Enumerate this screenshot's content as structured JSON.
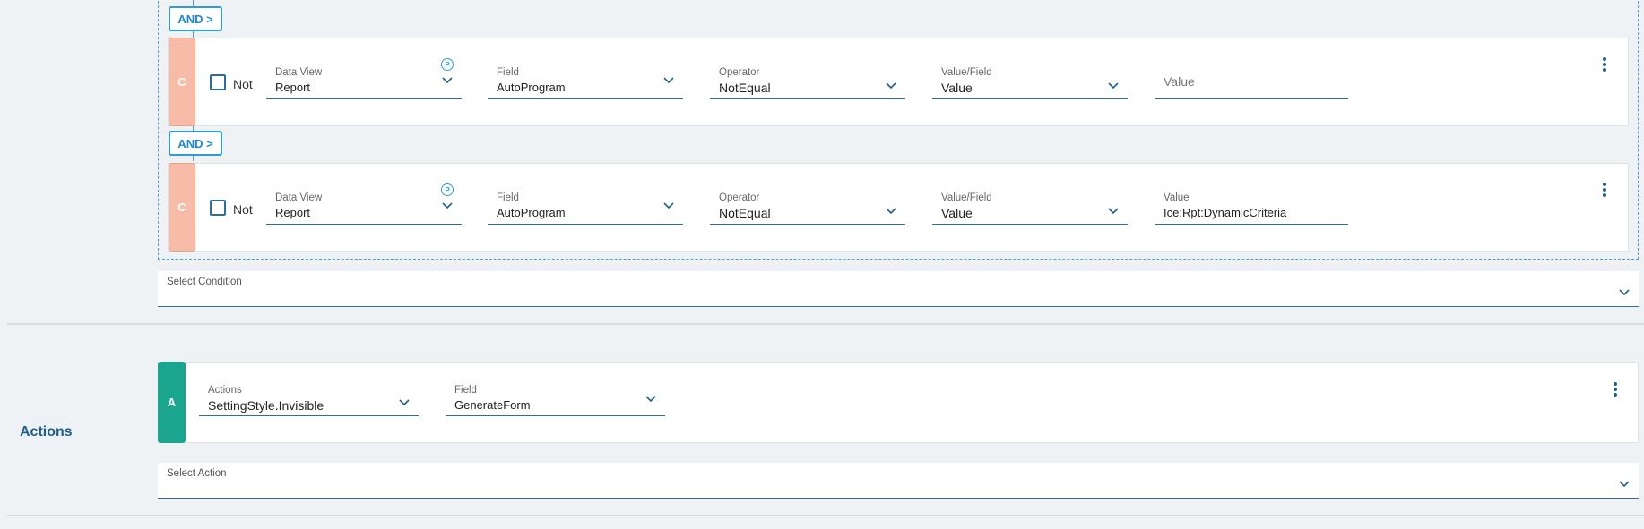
{
  "conditions": {
    "connector_label": "AND >",
    "rows": [
      {
        "tag": "C",
        "not_label": "Not",
        "data_view": {
          "label": "Data View",
          "value": "Report",
          "icon": "P"
        },
        "field": {
          "label": "Field",
          "value": "AutoProgram"
        },
        "operator": {
          "label": "Operator",
          "value": "NotEqual"
        },
        "value_field": {
          "label": "Value/Field",
          "value": "Value"
        },
        "value": {
          "label": "",
          "placeholder": "Value",
          "value": ""
        }
      },
      {
        "tag": "C",
        "not_label": "Not",
        "data_view": {
          "label": "Data View",
          "value": "Report",
          "icon": "P"
        },
        "field": {
          "label": "Field",
          "value": "AutoProgram"
        },
        "operator": {
          "label": "Operator",
          "value": "NotEqual"
        },
        "value_field": {
          "label": "Value/Field",
          "value": "Value"
        },
        "value": {
          "label": "Value",
          "placeholder": "",
          "value": "Ice:Rpt:DynamicCriteria"
        }
      }
    ],
    "select_label": "Select Condition"
  },
  "actions": {
    "section_title": "Actions",
    "rows": [
      {
        "tag": "A",
        "actions": {
          "label": "Actions",
          "value": "SettingStyle.Invisible"
        },
        "field": {
          "label": "Field",
          "value": "GenerateForm"
        }
      }
    ],
    "select_label": "Select Action"
  },
  "colors": {
    "condition_tag": "#f7bca7",
    "action_tag": "#1aa58f",
    "accent": "#2f9be0",
    "underline": "#2a6e9c"
  },
  "icons": {
    "chevron": "chevron-down-icon",
    "more": "more-vertical-icon",
    "parameter": "parameter-icon"
  }
}
